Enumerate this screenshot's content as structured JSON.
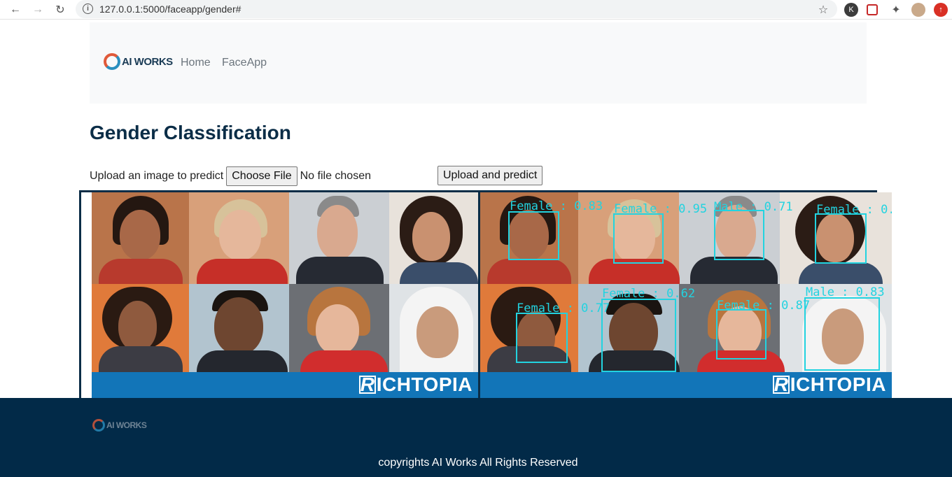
{
  "browser": {
    "url": "127.0.0.1:5000/faceapp/gender#",
    "back_icon": "arrow-left-icon",
    "forward_icon": "arrow-right-icon",
    "reload_icon": "reload-icon",
    "star_icon": "star-icon",
    "extension_k": "K"
  },
  "navbar": {
    "brand": "AI WORKS",
    "links": [
      "Home",
      "FaceApp"
    ]
  },
  "main": {
    "title": "Gender Classification",
    "upload_label": "Upload an image to predict",
    "choose_file": "Choose File",
    "no_file": "No file chosen",
    "submit": "Upload and predict"
  },
  "images": {
    "banner": "ICHTOPIA",
    "banner_r": "R",
    "predictions": [
      "Female : 0.83",
      "Female : 0.95",
      "Male : 0.71",
      "Female : 0.",
      "Female : 0.77",
      "Female : 0.62",
      "Female : 0.87",
      "Male : 0.83"
    ]
  },
  "footer": {
    "brand": "AI WORKS",
    "copyright": "copyrights AI Works All Rights Reserved"
  },
  "colors": {
    "primary": "#0b2d47",
    "footer_bg": "#022a48",
    "box": "#22d3e0",
    "banner": "#1275b8"
  }
}
